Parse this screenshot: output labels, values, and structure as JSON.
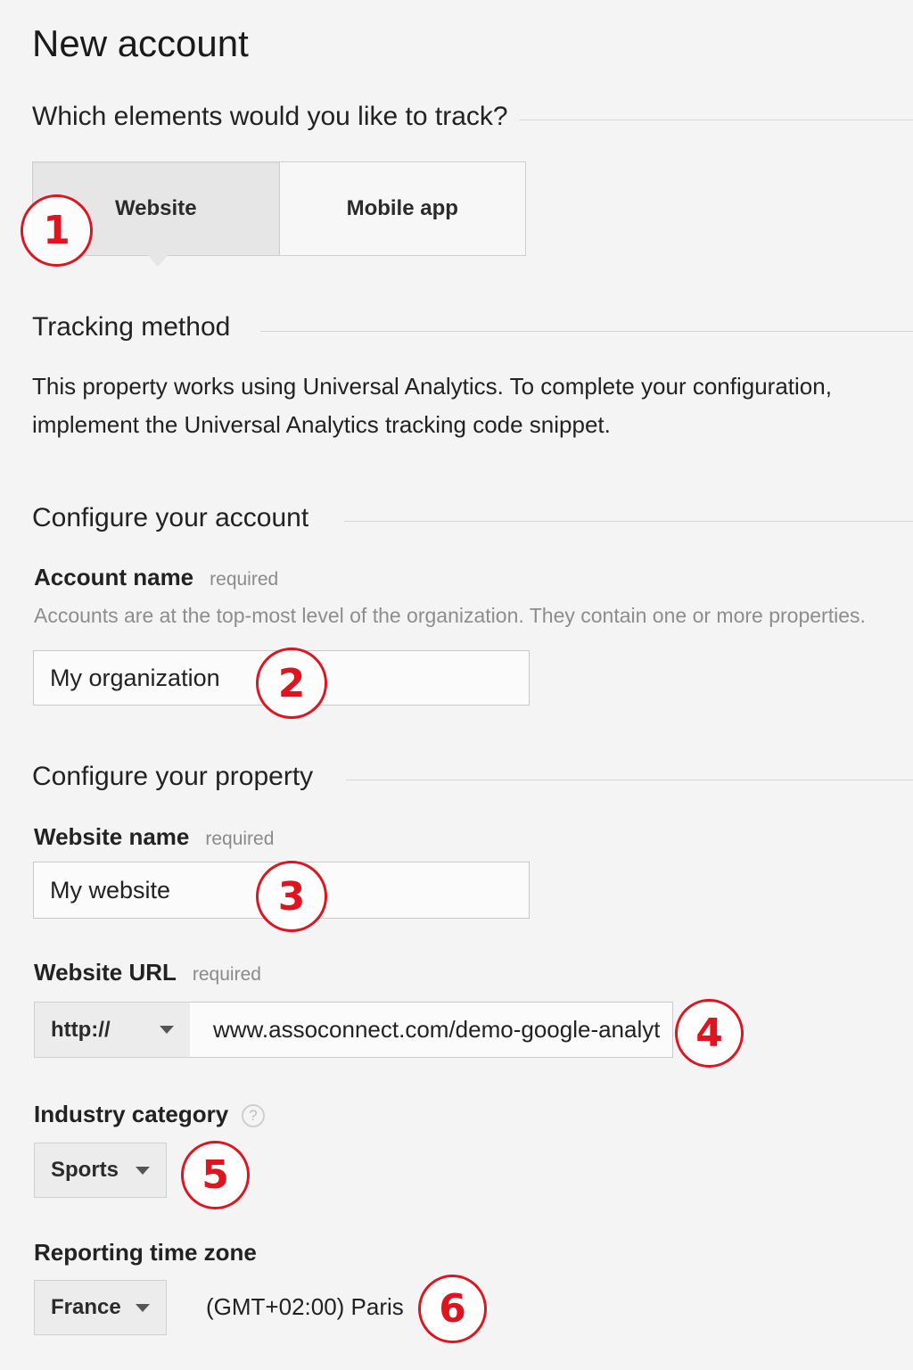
{
  "page": {
    "title": "New account"
  },
  "track_section": {
    "question": "Which elements would you like to track?",
    "options": [
      "Website",
      "Mobile app"
    ],
    "selected": "Website"
  },
  "tracking_method": {
    "title": "Tracking method",
    "description_line1": "This property works using Universal Analytics. To complete your configuration,",
    "description_line2": "implement the Universal Analytics tracking code snippet."
  },
  "account_section": {
    "title": "Configure your account",
    "account_name": {
      "label": "Account name",
      "required_text": "required",
      "helper": "Accounts are at the top-most level of the organization. They contain one or more properties.",
      "value": "My organization"
    }
  },
  "property_section": {
    "title": "Configure your property",
    "website_name": {
      "label": "Website name",
      "required_text": "required",
      "value": "My website"
    },
    "website_url": {
      "label": "Website URL",
      "required_text": "required",
      "protocol": "http://",
      "value": "www.assoconnect.com/demo-google-analytics"
    },
    "industry_category": {
      "label": "Industry category",
      "help_glyph": "?",
      "value": "Sports"
    },
    "time_zone": {
      "label": "Reporting time zone",
      "country": "France",
      "zone": "(GMT+02:00) Paris"
    }
  },
  "annotations": {
    "color": "#e0141e",
    "markers": [
      "1",
      "2",
      "3",
      "4",
      "5",
      "6"
    ]
  }
}
